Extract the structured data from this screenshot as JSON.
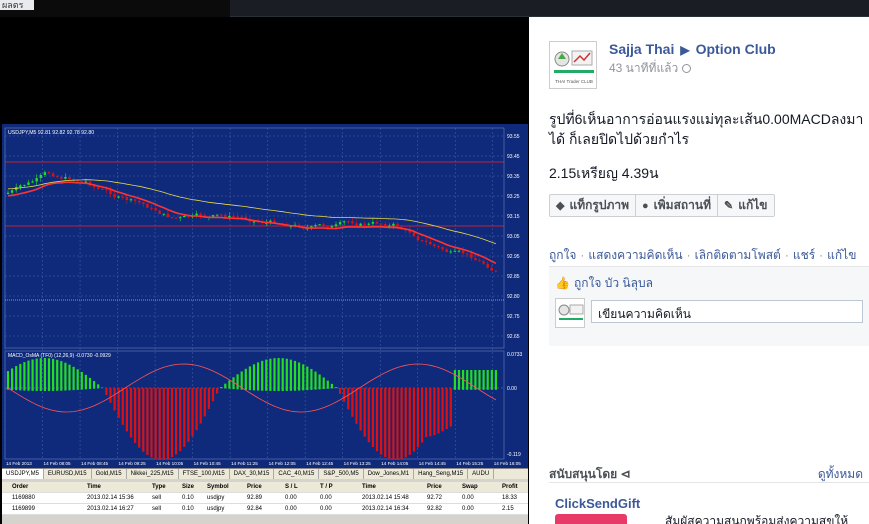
{
  "window": {
    "top_left_text": "ผลตร"
  },
  "photo": {
    "chart_symbol": "USDJPY,M5",
    "chart_ohlc": "92.81 92.82 92.78 92.80",
    "price_ticks": [
      "93.55",
      "93.45",
      "93.35",
      "93.25",
      "93.15",
      "93.05",
      "92.95",
      "92.85",
      "92.80",
      "92.75",
      "92.65"
    ],
    "time_ticks": [
      "14 Feb 2013",
      "14 Feb 08:05",
      "14 Feb 08:45",
      "14 Feb 09:25",
      "14 Feb 10:05",
      "14 Feb 10:45",
      "14 Feb 11:25",
      "14 Feb 12:05",
      "14 Feb 12:45",
      "14 Feb 13:25",
      "14 Feb 14:05",
      "14 Feb 14:45",
      "14 Feb 15:25",
      "14 Feb 16:05"
    ],
    "indicator_label": "MACD_OsMA (TF0) (12,26,9) -0.0730 -0.0929",
    "indicator_ticks": [
      "0.0733",
      "0.00",
      "-0.119"
    ],
    "tabs": [
      "USDJPY,M5",
      "EURUSD,M15",
      "Gold,M15",
      "Nikkei_225,M15",
      "FTSE_100,M15",
      "DAX_30,M15",
      "CAC_40,M15",
      "S&P_500,M5",
      "Dow_Jones,M1",
      "Hang_Seng,M15",
      "AUDU"
    ],
    "table": {
      "headers": [
        "Order",
        "Time",
        "Type",
        "Size",
        "Symbol",
        "Price",
        "S / L",
        "T / P",
        "Time",
        "Price",
        "Swap",
        "Profit"
      ],
      "rows": [
        [
          "1169880",
          "2013.02.14 15:36",
          "sell",
          "0.10",
          "usdjpy",
          "92.89",
          "0.00",
          "0.00",
          "2013.02.14 15:48",
          "92.72",
          "0.00",
          "18.33"
        ],
        [
          "1169899",
          "2013.02.14 16:27",
          "sell",
          "0.10",
          "usdjpy",
          "92.84",
          "0.00",
          "0.00",
          "2013.02.14 16:34",
          "92.82",
          "0.00",
          "2.15"
        ]
      ]
    }
  },
  "post": {
    "author": "Sajja Thai",
    "page": "Option Club",
    "time": "43 นาทีที่แล้ว",
    "text": "รูปที่6เห็นอาการอ่อนแรงแม่ทุละเส้น0.00MACDลงมาได้ ก็เลยปิดไปด้วยกำไร",
    "text2": "2.15เหรียญ 4.39น",
    "avatar_caption": "THAI Trader CLUB",
    "tag_buttons": [
      "แท็กรูปภาพ",
      "เพิ่มสถานที่",
      "แก้ไข"
    ],
    "actions": [
      "ถูกใจ",
      "แสดงความคิดเห็น",
      "เลิกติดตามโพสต์",
      "แชร์",
      "แก้ไข"
    ],
    "likes_label": "ถูกใจ",
    "likes_name": "บัว นิลุบล",
    "comment_placeholder": "เขียนความคิดเห็น",
    "sponsored": "สนับสนุนโดย",
    "see_all": "ดูทั้งหมด",
    "ad_title": "ClickSendGift",
    "ad_text": "สัมผัสความสนุกพร้อมส่งความสุขให้"
  },
  "colors": {
    "chart_bg": "#0f2a7a",
    "bull": "#22dd22",
    "bear": "#dd1111",
    "accent": "#3b5998"
  }
}
